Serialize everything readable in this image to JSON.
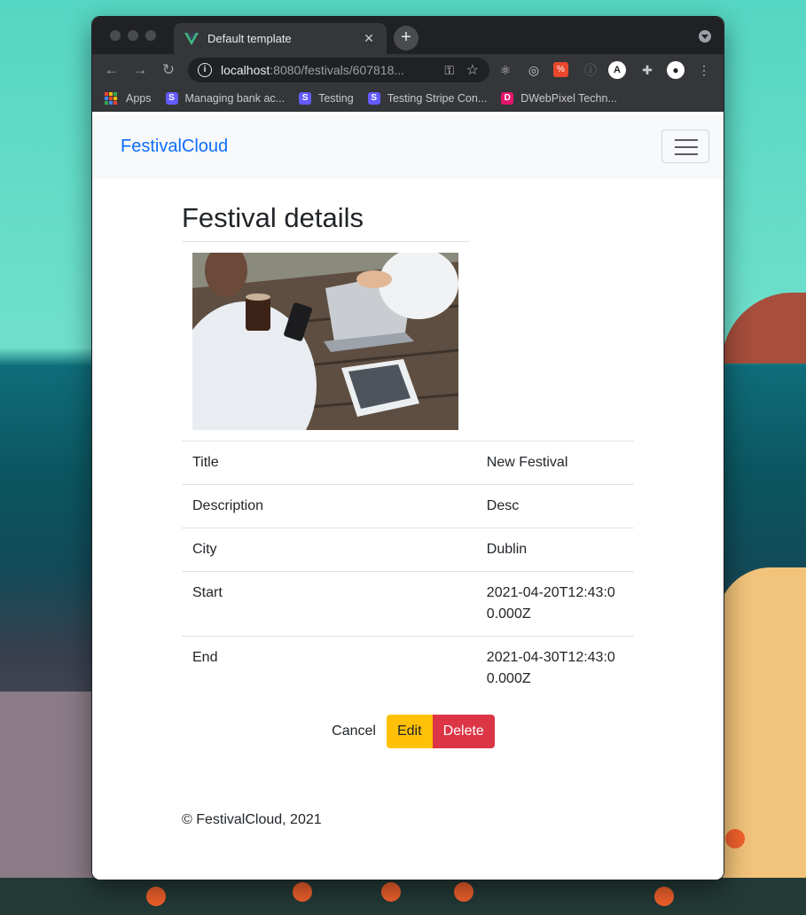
{
  "browser": {
    "tab_title": "Default template",
    "new_tab": "+",
    "url_host": "localhost",
    "url_path": ":8080/festivals/607818...",
    "bookmarks": [
      {
        "label": "Apps",
        "color": "#e8eaed"
      },
      {
        "label": "Managing bank ac...",
        "icon_letter": "S",
        "color": "#635bff"
      },
      {
        "label": "Testing",
        "icon_letter": "S",
        "color": "#635bff"
      },
      {
        "label": "Testing Stripe Con...",
        "icon_letter": "S",
        "color": "#635bff"
      },
      {
        "label": "DWebPixel Techn...",
        "icon_letter": "D",
        "color": "#e5156c"
      }
    ]
  },
  "navbar": {
    "brand": "FestivalCloud"
  },
  "page": {
    "heading": "Festival details",
    "photo_alt": "festival image",
    "details": [
      {
        "label": "Title",
        "value": "New Festival"
      },
      {
        "label": "Description",
        "value": "Desc"
      },
      {
        "label": "City",
        "value": "Dublin"
      },
      {
        "label": "Start",
        "value": "2021-04-20T12:43:00.000Z"
      },
      {
        "label": "End",
        "value": "2021-04-30T12:43:00.000Z"
      }
    ],
    "actions": {
      "cancel": "Cancel",
      "edit": "Edit",
      "delete": "Delete"
    },
    "footer": "© FestivalCloud, 2021"
  },
  "colors": {
    "brand": "#0d6efd",
    "edit_button": "#ffc107",
    "delete_button": "#dc3545"
  }
}
